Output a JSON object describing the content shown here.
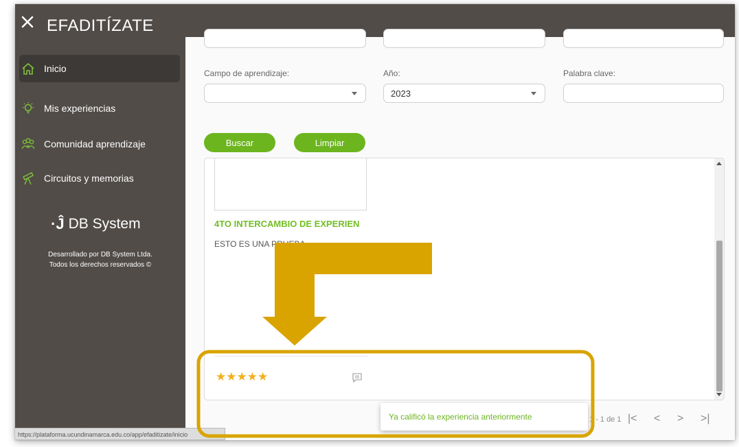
{
  "app": {
    "title": "EFADITÍZATE"
  },
  "sidebar": {
    "items": [
      {
        "label": "Inicio",
        "icon": "home-icon",
        "active": true
      },
      {
        "label": "Mis experiencias",
        "icon": "lightbulb-icon",
        "active": false
      },
      {
        "label": "Comunidad aprendizaje",
        "icon": "community-icon",
        "active": false
      },
      {
        "label": "Circuitos y memorias",
        "icon": "telescope-icon",
        "active": false
      }
    ],
    "brand_name": "DB System",
    "credits_line1": "Desarrollado por DB System Ltda.",
    "credits_line2": "Todos los derechos reservados ©"
  },
  "filters": {
    "campo_label": "Campo de aprendizaje:",
    "campo_value": "",
    "anio_label": "Año:",
    "anio_value": "2023",
    "keyword_label": "Palabra clave:",
    "keyword_value": ""
  },
  "actions": {
    "search_label": "Buscar",
    "clear_label": "Limpiar"
  },
  "experience": {
    "title": "4TO INTERCAMBIO DE EXPERIEN",
    "description": "ESTO ES UNA PRUEBA",
    "stars": "★★★★★"
  },
  "pagination": {
    "range": "1 - 1 de 1",
    "first": "|<",
    "prev": "<",
    "next": ">",
    "last": ">|"
  },
  "toast": {
    "message": "Ya calificó la experiencia anteriormente"
  },
  "status_url": "https://plataforma.ucundinamarca.edu.co/app/efaditizate/inicio",
  "colors": {
    "sidebar": "#514c48",
    "accent_green": "#6cb51e",
    "annotation_gold": "#d9a400",
    "stars": "#f2b01e"
  }
}
